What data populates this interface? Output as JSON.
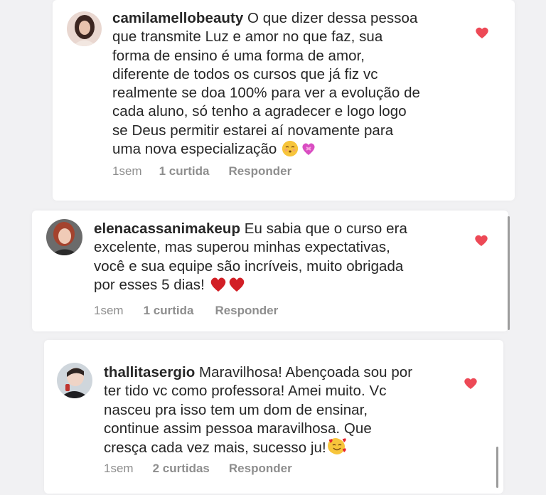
{
  "colors": {
    "heart": "#ed4956",
    "meta_text": "#8e8e8e",
    "text": "#262626",
    "card_bg": "#ffffff",
    "page_bg": "#f1f1f3"
  },
  "comments": [
    {
      "username": "camilamellobeauty",
      "lines": [
        " O que dizer dessa pessoa",
        "que transmite Luz e amor no que faz, sua",
        "forma de ensino é uma forma de amor,",
        "diferente de todos os cursos que já fiz vc",
        "realmente se doa 100% para ver a evolução de",
        "cada aluno, só tenho a agradecer e logo logo",
        "se Deus permitir estarei aí novamente para",
        "uma nova especialização "
      ],
      "emojis": [
        "kissing-face-icon",
        "heart-with-ribbon-icon"
      ],
      "time": "1sem",
      "likes": "1 curtida",
      "reply": "Responder"
    },
    {
      "username": "elenacassanimakeup",
      "lines": [
        " Eu sabia que o curso era",
        "excelente, mas superou minhas expectativas,",
        "você e sua equipe são incríveis, muito obrigada",
        "por esses 5 dias! "
      ],
      "emojis": [
        "red-heart-icon",
        "red-heart-icon"
      ],
      "time": "1sem",
      "likes": "1 curtida",
      "reply": "Responder"
    },
    {
      "username": "thallitasergio",
      "lines": [
        " Maravilhosa! Abençoada sou por",
        "ter tido vc como professora! Amei muito. Vc",
        "nasceu pra isso tem um dom de ensinar,",
        "continue assim pessoa maravilhosa. Que",
        "cresça cada vez mais, sucesso ju!"
      ],
      "emojis": [
        "smiling-face-with-hearts-icon"
      ],
      "time": "1sem",
      "likes": "2 curtidas",
      "reply": "Responder"
    }
  ]
}
